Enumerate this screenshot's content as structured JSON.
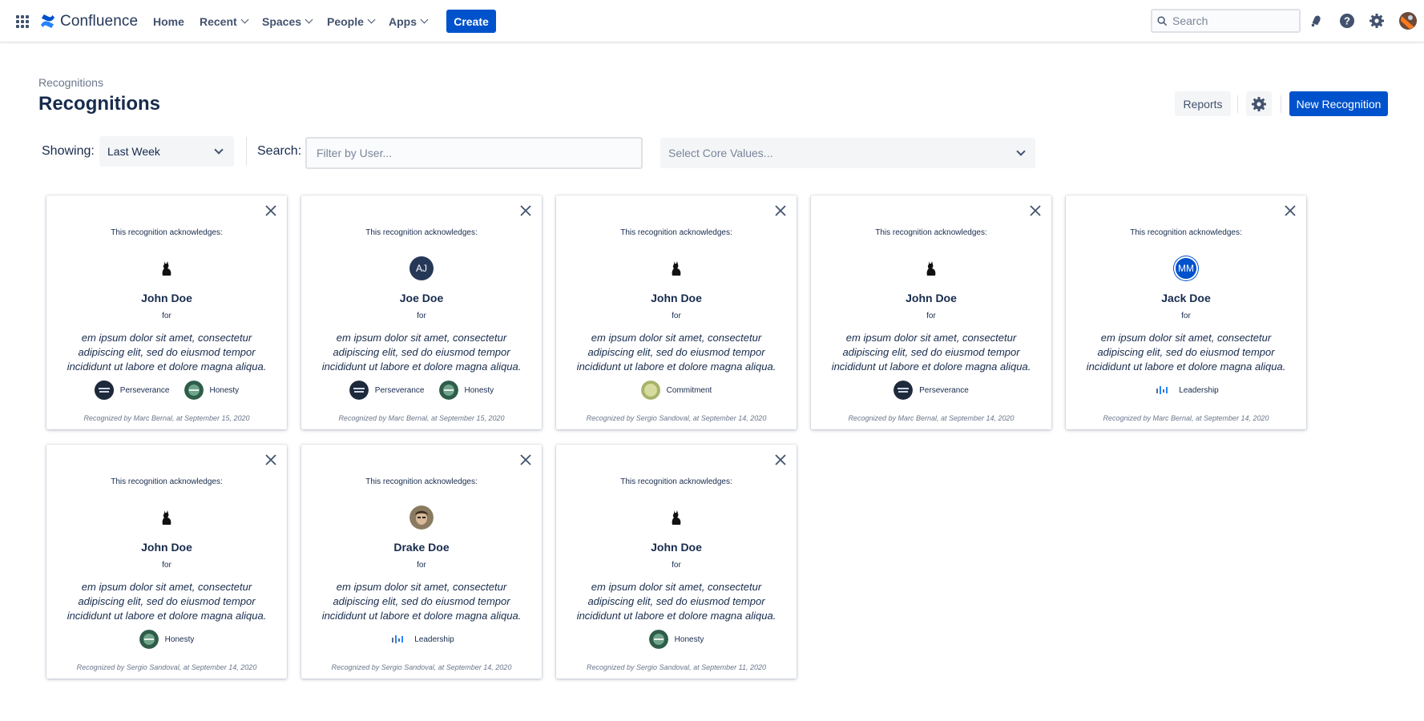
{
  "nav": {
    "brand": "Confluence",
    "home": "Home",
    "recent": "Recent",
    "spaces": "Spaces",
    "people": "People",
    "apps": "Apps",
    "create": "Create",
    "search_placeholder": "Search"
  },
  "page": {
    "breadcrumb": "Recognitions",
    "title": "Recognitions",
    "reports_label": "Reports",
    "new_recognition_label": "New Recognition"
  },
  "filters": {
    "showing_label": "Showing:",
    "period_value": "Last Week",
    "search_label": "Search:",
    "user_placeholder": "Filter by User...",
    "core_values_placeholder": "Select Core Values..."
  },
  "colors": {
    "primary": "#0052cc",
    "text": "#172b4d",
    "subtle": "#6b778c",
    "avatar_aj": "#253858",
    "avatar_mm": "#0052cc"
  },
  "card_text": {
    "acknowledges": "This recognition acknowledges:",
    "for": "for"
  },
  "cards": [
    {
      "name": "John Doe",
      "avatar": "cat-icon",
      "message": "em ipsum dolor sit amet, consectetur adipiscing elit, sed do eiusmod tempor incididunt ut labore et dolore magna aliqua.",
      "values": [
        "Perseverance",
        "Honesty"
      ],
      "footer": "Recognized by Marc Bernal, at September 15, 2020"
    },
    {
      "name": "Joe Doe",
      "avatar": "AJ",
      "message": "em ipsum dolor sit amet, consectetur adipiscing elit, sed do eiusmod tempor incididunt ut labore et dolore magna aliqua.",
      "values": [
        "Perseverance",
        "Honesty"
      ],
      "footer": "Recognized by Marc Bernal, at September 15, 2020"
    },
    {
      "name": "John Doe",
      "avatar": "cat-icon",
      "message": "em ipsum dolor sit amet, consectetur adipiscing elit, sed do eiusmod tempor incididunt ut labore et dolore magna aliqua.",
      "values": [
        "Commitment"
      ],
      "footer": "Recognized by Sergio Sandoval, at September 14, 2020"
    },
    {
      "name": "John Doe",
      "avatar": "cat-icon",
      "message": "em ipsum dolor sit amet, consectetur adipiscing elit, sed do eiusmod tempor incididunt ut labore et dolore magna aliqua.",
      "values": [
        "Perseverance"
      ],
      "footer": "Recognized by Marc Bernal, at September 14, 2020"
    },
    {
      "name": "Jack Doe",
      "avatar": "MM",
      "message": "em ipsum dolor sit amet, consectetur adipiscing elit, sed do eiusmod tempor incididunt ut labore et dolore magna aliqua.",
      "values": [
        "Leadership"
      ],
      "footer": "Recognized by Marc Bernal, at September 14, 2020"
    },
    {
      "name": "John Doe",
      "avatar": "cat-icon",
      "message": "em ipsum dolor sit amet, consectetur adipiscing elit, sed do eiusmod tempor incididunt ut labore et dolore magna aliqua.",
      "values": [
        "Honesty"
      ],
      "footer": "Recognized by Sergio Sandoval, at September 14, 2020"
    },
    {
      "name": "Drake Doe",
      "avatar": "person-photo",
      "message": "em ipsum dolor sit amet, consectetur adipiscing elit, sed do eiusmod tempor incididunt ut labore et dolore magna aliqua.",
      "values": [
        "Leadership"
      ],
      "footer": "Recognized by Sergio Sandoval, at September 14, 2020"
    },
    {
      "name": "John Doe",
      "avatar": "cat-icon",
      "message": "em ipsum dolor sit amet, consectetur adipiscing elit, sed do eiusmod tempor incididunt ut labore et dolore magna aliqua.",
      "values": [
        "Honesty"
      ],
      "footer": "Recognized by Sergio Sandoval, at September 11, 2020"
    }
  ]
}
